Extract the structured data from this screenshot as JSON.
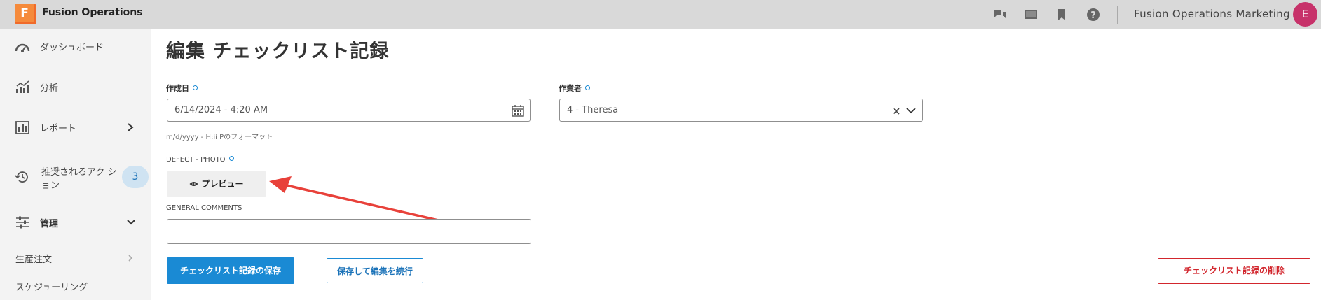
{
  "header": {
    "logo_letter": "F",
    "app_title": "Fusion Operations",
    "org_name": "Fusion Operations Marketing",
    "avatar_initial": "E"
  },
  "sidebar": {
    "items": [
      {
        "label": "ダッシュボード",
        "icon": "dashboard-icon"
      },
      {
        "label": "分析",
        "icon": "analytics-icon"
      },
      {
        "label": "レポート",
        "icon": "report-icon"
      },
      {
        "label": "推奨されるアク シ",
        "label2": "ョン",
        "icon": "history-icon",
        "badge": "3"
      },
      {
        "label": "管理",
        "icon": "sliders-icon"
      },
      {
        "label": "生産注文"
      },
      {
        "label": "スケジューリング"
      }
    ]
  },
  "main": {
    "page_title": "編集 チェックリスト記録",
    "created_date": {
      "label": "作成日",
      "value": "6/14/2024 - 4:20 AM",
      "hint": "m/d/yyyy - H:ii Pのフォーマット"
    },
    "worker": {
      "label": "作業者",
      "value": "4 - Theresa"
    },
    "defect_photo": {
      "label": "DEFECT - PHOTO",
      "preview_label": "プレビュー"
    },
    "general_comments": {
      "label": "GENERAL COMMENTS",
      "value": ""
    },
    "buttons": {
      "save": "チェックリスト記録の保存",
      "save_continue": "保存して編集を続行",
      "delete": "チェックリスト記録の削除"
    }
  },
  "colors": {
    "primary": "#1a8ad4",
    "danger": "#d2262d",
    "annotation_arrow": "#e8413a",
    "avatar": "#c7326a"
  }
}
